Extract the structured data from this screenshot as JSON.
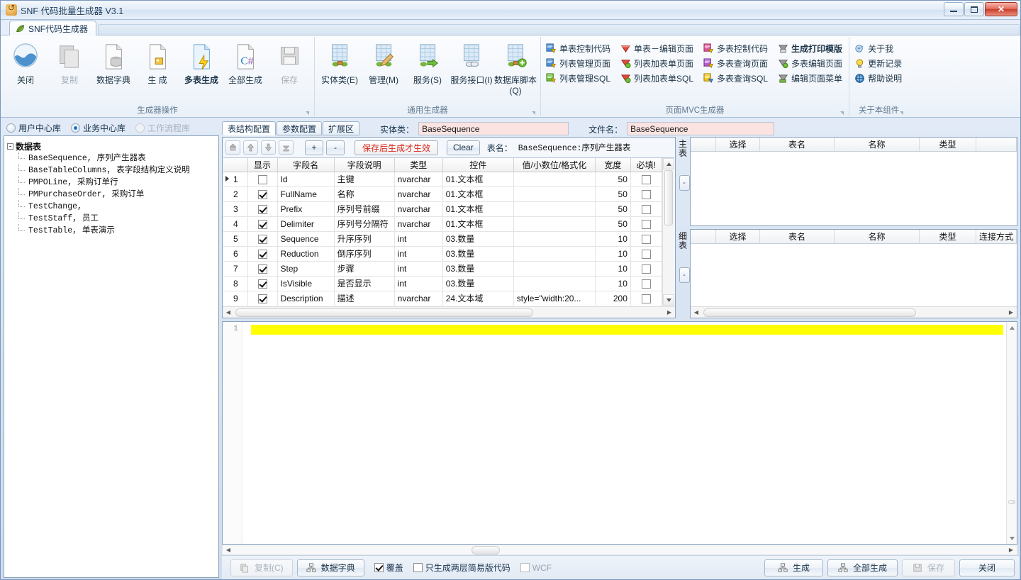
{
  "window": {
    "title": "SNF 代码批量生成器 V3.1",
    "app_icon": "refresh-icon",
    "minimize": "–",
    "maximize": "□",
    "close": "✕"
  },
  "ribbon": {
    "tab": {
      "label": "SNF代码生成器",
      "icon": "leaf-icon"
    },
    "groups": [
      {
        "title": "生成器操作",
        "type": "big",
        "items": [
          {
            "label": "关闭",
            "icon": "close-wave-icon",
            "state": "normal"
          },
          {
            "label": "复制",
            "icon": "copy-icon",
            "state": "disabled"
          },
          {
            "label": "数据字典",
            "icon": "data-dictionary-icon",
            "state": "normal"
          },
          {
            "label": "生 成",
            "icon": "generate-icon",
            "state": "normal"
          },
          {
            "label": "多表生成",
            "icon": "multi-table-generate-icon",
            "state": "bold"
          },
          {
            "label": "全部生成",
            "icon": "csharp-generate-icon",
            "state": "normal"
          },
          {
            "label": "保存",
            "icon": "save-icon",
            "state": "disabled"
          }
        ]
      },
      {
        "title": "通用生成器",
        "type": "big",
        "items": [
          {
            "label": "实体类(E)",
            "icon": "entity-class-icon",
            "state": "normal"
          },
          {
            "label": "管理(M)",
            "icon": "manage-icon",
            "state": "normal"
          },
          {
            "label": "服务(S)",
            "icon": "service-icon",
            "state": "normal"
          },
          {
            "label": "服务接口(I)",
            "icon": "service-interface-icon",
            "state": "normal"
          },
          {
            "label": "数据库脚本(Q)",
            "icon": "db-script-icon",
            "state": "normal"
          }
        ]
      },
      {
        "title": "页面MVC生成器",
        "type": "small-grid",
        "columns": [
          [
            {
              "label": "单表控制代码",
              "icon": "page-blue-icon",
              "state": "normal"
            },
            {
              "label": "列表管理页面",
              "icon": "page-blue-icon",
              "state": "normal"
            },
            {
              "label": "列表管理SQL",
              "icon": "page-green-icon",
              "state": "normal"
            }
          ],
          [
            {
              "label": "单表－编辑页面",
              "icon": "diamond-red-icon",
              "state": "normal"
            },
            {
              "label": "列表加表单页面",
              "icon": "diamond-green-icon",
              "state": "normal"
            },
            {
              "label": "列表加表单SQL",
              "icon": "diamond-green-icon",
              "state": "normal"
            }
          ],
          [
            {
              "label": "多表控制代码",
              "icon": "page-pink-icon",
              "state": "normal"
            },
            {
              "label": "多表查询页面",
              "icon": "page-purple-icon",
              "state": "normal"
            },
            {
              "label": "多表查询SQL",
              "icon": "page-yellow-icon",
              "state": "normal"
            }
          ],
          [
            {
              "label": "生成打印模版",
              "icon": "print-template-icon",
              "state": "bold"
            },
            {
              "label": "多表编辑页面",
              "icon": "edit-page-icon",
              "state": "normal"
            },
            {
              "label": "编辑页面菜单",
              "icon": "page-menu-icon",
              "state": "normal"
            }
          ]
        ]
      },
      {
        "title": "关于本组件",
        "type": "small-list",
        "items": [
          {
            "label": "关于我",
            "icon": "about-icon",
            "state": "normal"
          },
          {
            "label": "更新记录",
            "icon": "bulb-icon",
            "state": "normal"
          },
          {
            "label": "帮助说明",
            "icon": "help-icon",
            "state": "normal"
          }
        ]
      }
    ]
  },
  "left_panel": {
    "db_radios": [
      {
        "label": "用户中心库",
        "selected": false,
        "disabled": false
      },
      {
        "label": "业务中心库",
        "selected": true,
        "disabled": false
      },
      {
        "label": "工作流程库",
        "selected": false,
        "disabled": true
      }
    ],
    "tree": {
      "root": "数据表",
      "toggle": "-",
      "nodes": [
        "BaseSequence, 序列产生器表",
        "BaseTableColumns, 表字段结构定义说明",
        "PMPOLine, 采购订单行",
        "PMPurchaseOrder, 采购订单",
        "TestChange,",
        "TestStaff, 员工",
        "TestTable, 单表演示"
      ]
    }
  },
  "config": {
    "tabs": [
      {
        "label": "表结构配置",
        "active": true
      },
      {
        "label": "参数配置",
        "active": false
      },
      {
        "label": "扩展区",
        "active": false
      }
    ],
    "entity_class": {
      "label": "实体类：",
      "value": "BaseSequence"
    },
    "file_name": {
      "label": "文件名：",
      "value": "BaseSequence"
    }
  },
  "grid_toolbar": {
    "arrows": [
      "move-top",
      "move-up",
      "move-down",
      "move-bottom"
    ],
    "add": "+",
    "remove": "-",
    "warn_label": "保存后生成才生效",
    "clear_label": "Clear",
    "table_name_label": "表名：",
    "table_name_value": "BaseSequence:序列产生器表"
  },
  "grid": {
    "columns": [
      "",
      "显示",
      "字段名",
      "字段说明",
      "类型",
      "控件",
      "值/小数位/格式化",
      "宽度",
      "必填!"
    ],
    "rows": [
      {
        "idx": "1",
        "current": true,
        "show": false,
        "field": "Id",
        "desc": "主键",
        "type": "nvarchar",
        "control": "01.文本框",
        "value": "",
        "width": "50",
        "required": false
      },
      {
        "idx": "2",
        "current": false,
        "show": true,
        "field": "FullName",
        "desc": "名称",
        "type": "nvarchar",
        "control": "01.文本框",
        "value": "",
        "width": "50",
        "required": false
      },
      {
        "idx": "3",
        "current": false,
        "show": true,
        "field": "Prefix",
        "desc": "序列号前缀",
        "type": "nvarchar",
        "control": "01.文本框",
        "value": "",
        "width": "50",
        "required": false
      },
      {
        "idx": "4",
        "current": false,
        "show": true,
        "field": "Delimiter",
        "desc": "序列号分隔符",
        "type": "nvarchar",
        "control": "01.文本框",
        "value": "",
        "width": "50",
        "required": false
      },
      {
        "idx": "5",
        "current": false,
        "show": true,
        "field": "Sequence",
        "desc": "升序序列",
        "type": "int",
        "control": "03.数量",
        "value": "",
        "width": "10",
        "required": false
      },
      {
        "idx": "6",
        "current": false,
        "show": true,
        "field": "Reduction",
        "desc": "倒序序列",
        "type": "int",
        "control": "03.数量",
        "value": "",
        "width": "10",
        "required": false
      },
      {
        "idx": "7",
        "current": false,
        "show": true,
        "field": "Step",
        "desc": "步骤",
        "type": "int",
        "control": "03.数量",
        "value": "",
        "width": "10",
        "required": false
      },
      {
        "idx": "8",
        "current": false,
        "show": true,
        "field": "IsVisible",
        "desc": "是否显示",
        "type": "int",
        "control": "03.数量",
        "value": "",
        "width": "10",
        "required": false
      },
      {
        "idx": "9",
        "current": false,
        "show": true,
        "field": "Description",
        "desc": "描述",
        "type": "nvarchar",
        "control": "24.文本域",
        "value": "style=\"width:20...",
        "width": "200",
        "required": false
      }
    ]
  },
  "master_detail": {
    "master": {
      "side_label": "主表",
      "minus": "-",
      "columns": [
        "",
        "选择",
        "表名",
        "名称",
        "类型",
        ""
      ],
      "rows": []
    },
    "detail": {
      "side_label": "细表",
      "minus": "-",
      "columns": [
        "",
        "选择",
        "表名",
        "名称",
        "类型",
        "连接方式"
      ],
      "rows": []
    }
  },
  "editor": {
    "line_numbers": [
      "1"
    ],
    "lines": [
      ""
    ],
    "highlight_color": "#ffff00"
  },
  "bottom_bar": {
    "left_buttons": [
      {
        "label": "复制(C)",
        "icon": "copy-icon",
        "state": "disabled"
      },
      {
        "label": "数据字典",
        "icon": "data-dictionary-icon",
        "state": "normal"
      }
    ],
    "checkboxes": [
      {
        "label": "覆盖",
        "checked": true,
        "disabled": false
      },
      {
        "label": "只生成两层简易版代码",
        "checked": false,
        "disabled": false
      },
      {
        "label": "WCF",
        "checked": false,
        "disabled": true
      }
    ],
    "right_buttons": [
      {
        "label": "生成",
        "icon": "generate-tree-icon",
        "state": "normal"
      },
      {
        "label": "全部生成",
        "icon": "generate-tree-icon",
        "state": "normal"
      },
      {
        "label": "保存",
        "icon": "save-icon",
        "state": "disabled"
      },
      {
        "label": "关闭",
        "icon": "",
        "state": "normal"
      }
    ]
  },
  "colors": {
    "accent": "#1d74c8",
    "frame": "#7a97bd",
    "pink_field": "#fbe3e1",
    "warn_text": "#d9281e",
    "highlight": "#ffff00",
    "close_button": "#c83c27"
  }
}
